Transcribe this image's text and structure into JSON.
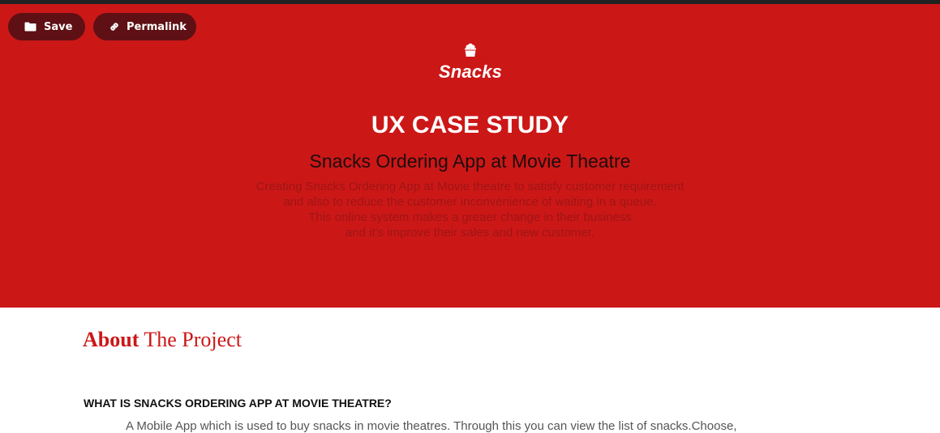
{
  "toolbar": {
    "save_label": "Save",
    "save_icon": "folder-icon",
    "permalink_label": "Permalink",
    "permalink_icon": "link-icon"
  },
  "hero": {
    "logo_text": "Snacks",
    "logo_icon": "popcorn-bucket-icon",
    "title": "UX CASE STUDY",
    "subtitle": "Snacks Ordering App at Movie Theatre",
    "description_lines": [
      "Creating Snacks Ordering App at Movie theatre to satisfy customer requirement",
      "and also to reduce the customer inconvenience of waiting in a queue.",
      "This online system makes a greaer change in their business",
      "and it's improve their sales and new customer."
    ],
    "background_color": "#cc1717"
  },
  "about": {
    "heading_bold": "About",
    "heading_rest": " The Project",
    "question": "WHAT IS SNACKS ORDERING APP AT MOVIE THEATRE?",
    "answer": "A Mobile App which is used to buy snacks in movie theatres. Through this you can view the list of snacks.Choose,"
  }
}
